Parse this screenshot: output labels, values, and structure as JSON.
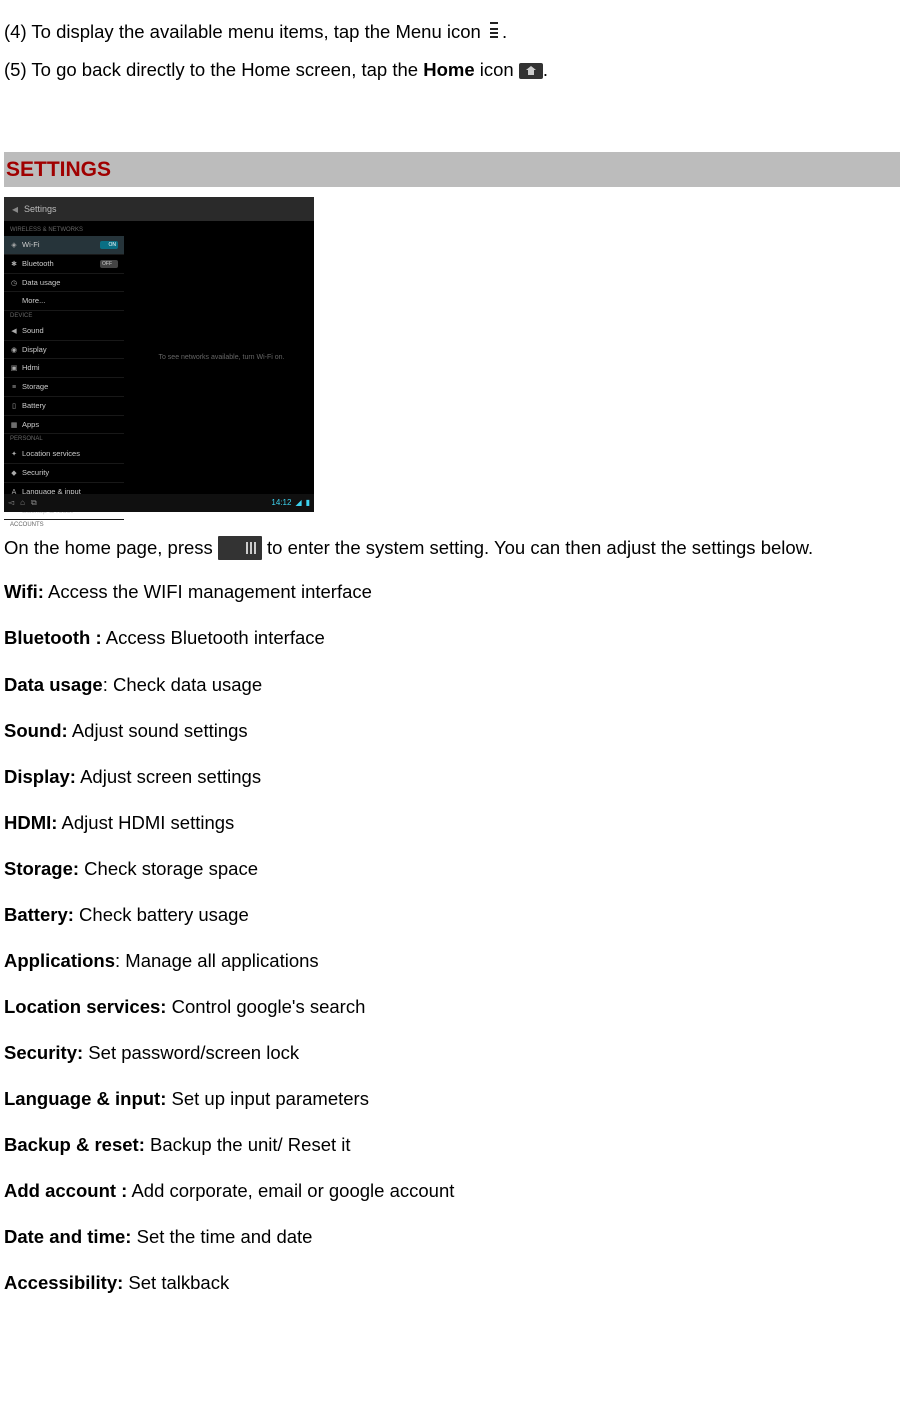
{
  "instructions": {
    "item4": {
      "prefix": "(4) To display the available menu items, tap the Menu icon ",
      "suffix": "."
    },
    "item5": {
      "prefix": "(5) To go back directly to the Home screen, tap the ",
      "bold": "Home",
      "mid": " icon ",
      "suffix": "."
    }
  },
  "section_heading": "SETTINGS",
  "screenshot": {
    "title": "Settings",
    "groups": {
      "wireless": "WIRELESS & NETWORKS",
      "device": "DEVICE",
      "personal": "PERSONAL",
      "accounts": "ACCOUNTS"
    },
    "items": {
      "wifi": "Wi-Fi",
      "bluetooth": "Bluetooth",
      "data_usage": "Data usage",
      "more": "More...",
      "sound": "Sound",
      "display": "Display",
      "hdmi": "Hdmi",
      "storage": "Storage",
      "battery": "Battery",
      "apps": "Apps",
      "location": "Location services",
      "security": "Security",
      "language": "Language & input",
      "backup": "Backup & reset"
    },
    "switch_on": "ON",
    "switch_off": "OFF",
    "detail_text": "To see networks available, turn Wi-Fi on.",
    "clock": "14:12",
    "battery": "▮"
  },
  "intro": {
    "before": "On the home page, press ",
    "after": " to enter the system setting. You can then adjust the settings below."
  },
  "settings_list": [
    {
      "label": "Wifi:",
      "desc": " Access the WIFI management interface"
    },
    {
      "label": "Bluetooth :",
      "desc": " Access Bluetooth interface"
    },
    {
      "label": "Data usage",
      "desc": ": Check data usage"
    },
    {
      "label": "Sound:",
      "desc": " Adjust sound settings"
    },
    {
      "label": "Display:",
      "desc": " Adjust screen settings"
    },
    {
      "label": "HDMI:",
      "desc": " Adjust HDMI settings"
    },
    {
      "label": "Storage:",
      "desc": " Check storage space"
    },
    {
      "label": "Battery:",
      "desc": " Check battery usage"
    },
    {
      "label": "Applications",
      "desc": ": Manage all applications"
    },
    {
      "label": "Location services:",
      "desc": " Control google's search"
    },
    {
      "label": "Security:",
      "desc": " Set password/screen lock"
    },
    {
      "label": "Language & input:",
      "desc": " Set up input parameters"
    },
    {
      "label": "Backup & reset:",
      "desc": " Backup the unit/ Reset it"
    },
    {
      "label": "Add account :",
      "desc": " Add corporate, email or google account"
    },
    {
      "label": "Date and time:",
      "desc": " Set the time and date"
    },
    {
      "label": "Accessibility:",
      "desc": " Set talkback"
    }
  ]
}
